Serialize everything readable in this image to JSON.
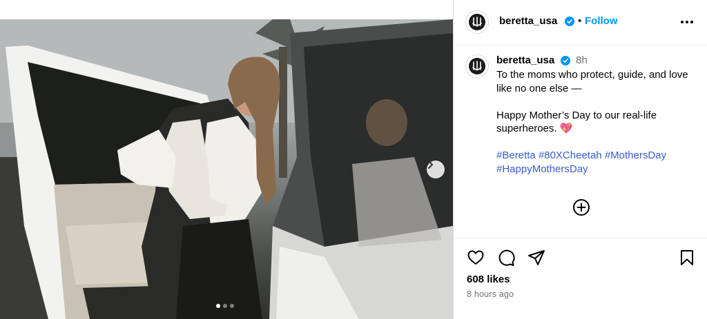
{
  "post": {
    "media": {
      "alt": "",
      "carousel_dots": 3,
      "active_dot": 0
    },
    "header": {
      "username": "beretta_usa",
      "separator": "•",
      "follow_label": "Follow"
    },
    "caption": {
      "username": "beretta_usa",
      "time_short": "8h",
      "line1": "To the moms who protect, guide, and love like no one else —",
      "line2": "Happy Mother’s Day to our real-life superheroes. 💖",
      "hashtags": [
        "#Beretta",
        "#80XCheetah",
        "#MothersDay",
        "#HappyMothersDay"
      ]
    },
    "stats": {
      "likes": "608 likes",
      "time_ago": "8 hours ago"
    }
  },
  "icons": {
    "verified": "verified-badge-icon",
    "more": "more-options-icon",
    "next": "chevron-right-icon",
    "add_comment": "add-circle-icon",
    "like": "heart-icon",
    "comment": "comment-icon",
    "share": "send-icon",
    "save": "bookmark-icon"
  },
  "colors": {
    "link": "#0095f6",
    "hashtag": "#3a5ccc",
    "verified": "#0095f6",
    "muted": "#737373"
  }
}
